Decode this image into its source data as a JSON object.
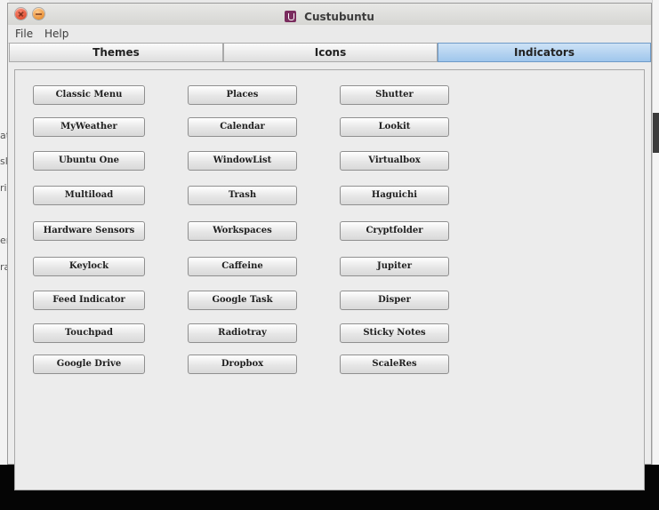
{
  "window": {
    "title": "Custubuntu"
  },
  "menu": {
    "file": "File",
    "help": "Help"
  },
  "tabs": [
    {
      "label": "Themes",
      "active": false
    },
    {
      "label": "Icons",
      "active": false
    },
    {
      "label": "Indicators",
      "active": true
    }
  ],
  "background_fragments": [
    "at",
    "sl",
    "ri",
    "er",
    "ra"
  ],
  "indicators": {
    "col1": [
      "Classic Menu",
      "MyWeather",
      "Ubuntu One",
      "Multiload",
      "Hardware Sensors",
      "Keylock",
      "Feed Indicator",
      "Touchpad",
      "Google Drive"
    ],
    "col2": [
      "Places",
      "Calendar",
      "WindowList",
      "Trash",
      "Workspaces",
      "Caffeine",
      "Google Task",
      "Radiotray",
      "Dropbox"
    ],
    "col3": [
      "Shutter",
      "Lookit",
      "Virtualbox",
      "Haguichi",
      "Cryptfolder",
      "Jupiter",
      "Disper",
      "Sticky Notes",
      "ScaleRes"
    ]
  },
  "colors": {
    "active_tab": "#a9cdf0",
    "window_bg": "#ececec"
  }
}
